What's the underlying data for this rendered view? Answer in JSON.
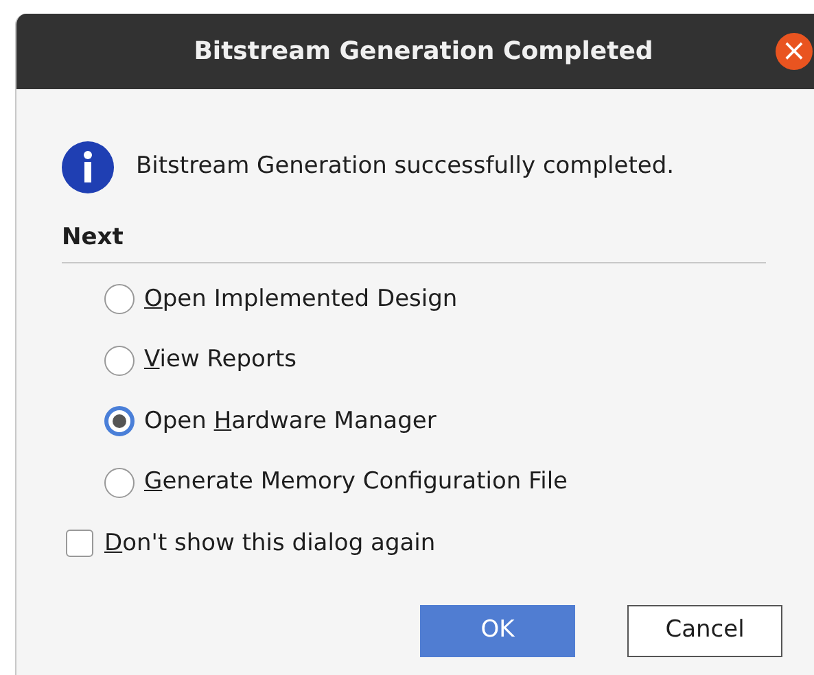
{
  "window": {
    "title": "Bitstream Generation Completed",
    "close_symbol": "×"
  },
  "message": "Bitstream Generation successfully completed.",
  "section": "Next",
  "options": [
    {
      "key": "O",
      "after": "pen Implemented Design",
      "selected": false
    },
    {
      "key": "V",
      "after": "iew Reports",
      "selected": false
    },
    {
      "before": "Open ",
      "key": "H",
      "after": "ardware Manager",
      "selected": true
    },
    {
      "key": "G",
      "after": "enerate Memory Configuration File",
      "selected": false
    }
  ],
  "dont_show": {
    "key": "D",
    "after": "on't show this dialog again",
    "checked": false
  },
  "buttons": [
    {
      "label": "OK",
      "kind": "primary"
    },
    {
      "label": "Cancel",
      "kind": "secondary"
    }
  ]
}
